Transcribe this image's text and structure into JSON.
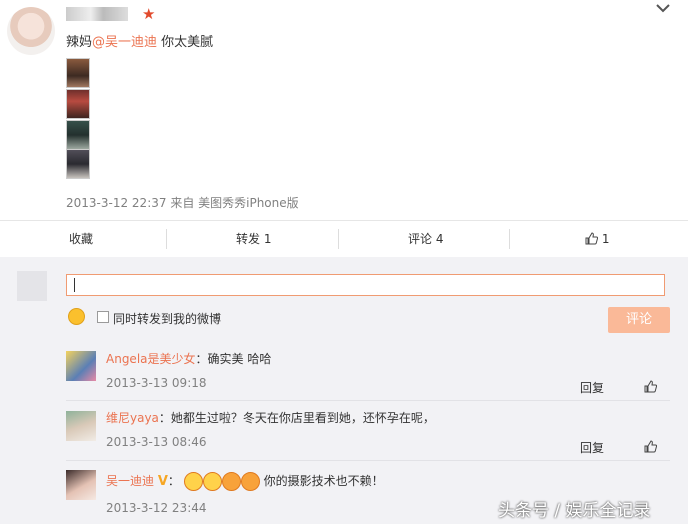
{
  "post": {
    "username_visible": "",
    "text_prefix": "辣妈",
    "mention": "@吴一迪迪",
    "text_suffix": " 你太美腻",
    "meta": "2013-3-12 22:37 来自 美图秀秀iPhone版"
  },
  "actions": {
    "collect": "收藏",
    "repost": "转发 1",
    "comment": "评论 4",
    "like": "1"
  },
  "composer": {
    "input_value": "",
    "repost_checkbox_label": "同时转发到我的微博",
    "submit_label": "评论"
  },
  "comments": [
    {
      "user": "Angela是美少女",
      "text": "：确实美 哈哈",
      "time": "2013-3-13 09:18",
      "reply": "回复"
    },
    {
      "user": "维尼yaya",
      "text": "：她都生过啦？冬天在你店里看到她，还怀孕在呢，",
      "time": "2013-3-13 08:46",
      "reply": "回复"
    },
    {
      "user": "吴一迪迪",
      "badge": "V",
      "text": "你的摄影技术也不赖！",
      "time": "2013-3-12 23:44"
    }
  ],
  "watermark": "头条号 / 娱乐全记录",
  "colors": {
    "accent": "#eb7350",
    "button": "#fab998",
    "comment_bg": "#f2f2f5"
  }
}
